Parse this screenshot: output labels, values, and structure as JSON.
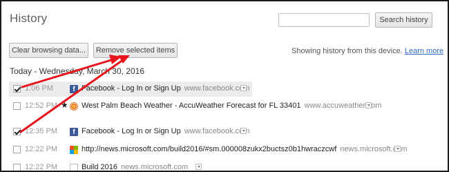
{
  "header": {
    "title": "History",
    "search_placeholder": "",
    "search_button": "Search history"
  },
  "toolbar": {
    "clear_button": "Clear browsing data...",
    "remove_button": "Remove selected items",
    "device_text": "Showing history from this device.",
    "learn_more": "Learn more"
  },
  "day_header": "Today - Wednesday, March 30, 2016",
  "entries": [
    {
      "checked": true,
      "time": "1:06 PM",
      "title": "Facebook - Log In or Sign Up",
      "domain": "www.facebook.com",
      "favicon": "facebook-icon",
      "starred": false
    },
    {
      "checked": false,
      "time": "12:52 PM",
      "title": "West Palm Beach Weather - AccuWeather Forecast for FL 33401",
      "domain": "www.accuweather.com",
      "favicon": "accuweather-icon",
      "starred": true
    },
    {
      "checked": true,
      "time": "12:35 PM",
      "title": "Facebook - Log In or Sign Up",
      "domain": "www.facebook.com",
      "favicon": "facebook-icon",
      "starred": false
    },
    {
      "checked": false,
      "time": "12:22 PM",
      "title": "http://news.microsoft.com/build2016/#sm.000008zukx2buctsz0b1hwraczcwf",
      "domain": "news.microsoft.com",
      "favicon": "microsoft-icon",
      "starred": false
    },
    {
      "checked": false,
      "time": "12:22 PM",
      "title": "Build 2016",
      "domain": "news.microsoft.com",
      "favicon": "blank-page-icon",
      "starred": false
    }
  ],
  "colors": {
    "link": "#2a6ac0",
    "annotation_arrow": "#e8141c",
    "highlight_row": "#ececec"
  }
}
